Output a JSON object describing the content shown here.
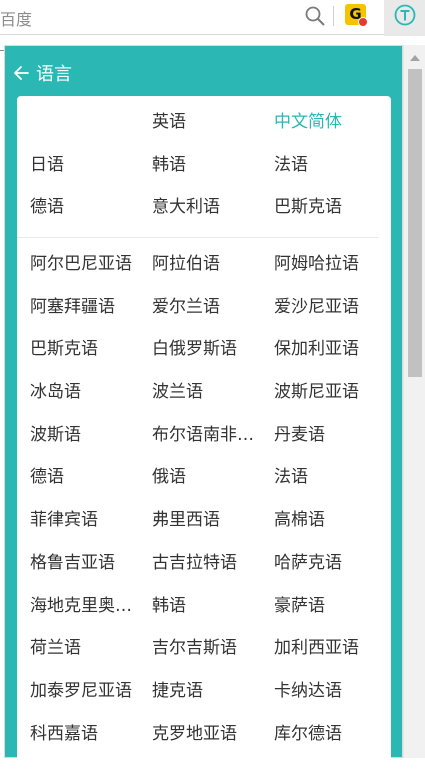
{
  "toolbar": {
    "search_text": "百度",
    "ext_g_label": "G"
  },
  "popup": {
    "accent_color": "#2bb7b3",
    "back_label": "语言",
    "top_languages": [
      {
        "label": "",
        "selected": false
      },
      {
        "label": "英语",
        "selected": false
      },
      {
        "label": "中文简体",
        "selected": true
      },
      {
        "label": "日语",
        "selected": false
      },
      {
        "label": "韩语",
        "selected": false
      },
      {
        "label": "法语",
        "selected": false
      },
      {
        "label": "德语",
        "selected": false
      },
      {
        "label": "意大利语",
        "selected": false
      },
      {
        "label": "巴斯克语",
        "selected": false
      }
    ],
    "all_languages": [
      "阿尔巴尼亚语",
      "阿拉伯语",
      "阿姆哈拉语",
      "阿塞拜疆语",
      "爱尔兰语",
      "爱沙尼亚语",
      "巴斯克语",
      "白俄罗斯语",
      "保加利亚语",
      "冰岛语",
      "波兰语",
      "波斯尼亚语",
      "波斯语",
      "布尔语南非…",
      "丹麦语",
      "德语",
      "俄语",
      "法语",
      "菲律宾语",
      "弗里西语",
      "高棉语",
      "格鲁吉亚语",
      "古吉拉特语",
      "哈萨克语",
      "海地克里奥…",
      "韩语",
      "豪萨语",
      "荷兰语",
      "吉尔吉斯语",
      "加利西亚语",
      "加泰罗尼亚语",
      "捷克语",
      "卡纳达语",
      "科西嘉语",
      "克罗地亚语",
      "库尔德语"
    ]
  }
}
